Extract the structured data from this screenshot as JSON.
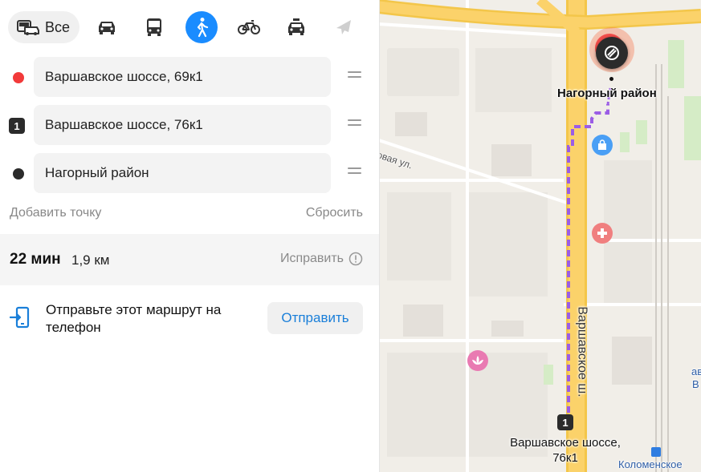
{
  "modes": {
    "all_label": "Все",
    "items": [
      {
        "name": "car-icon"
      },
      {
        "name": "bus-icon"
      },
      {
        "name": "pedestrian-icon",
        "active": true
      },
      {
        "name": "bicycle-icon"
      },
      {
        "name": "taxi-icon"
      },
      {
        "name": "airplane-icon"
      }
    ]
  },
  "route_points": [
    {
      "marker": "red-dot",
      "value": "Варшавское шоссе, 69к1"
    },
    {
      "marker": "number-badge",
      "marker_text": "1",
      "value": "Варшавское шоссе, 76к1"
    },
    {
      "marker": "black-dot",
      "value": "Нагорный район"
    }
  ],
  "actions": {
    "add_point": "Добавить точку",
    "reset": "Сбросить"
  },
  "summary": {
    "time": "22 мин",
    "distance": "1,9 км",
    "fix": "Исправить"
  },
  "send": {
    "text": "Отправьте этот маршрут на телефон",
    "button": "Отправить"
  },
  "map": {
    "destination_label": "Нагорный район",
    "street_label": "Варшавское ш.",
    "street_fragment": "овая ул.",
    "waypoint_badge": "1",
    "waypoint_label_line1": "Варшавское шоссе,",
    "waypoint_label_line2": "76к1",
    "metro_label": "Коломенское",
    "edge_label_1": "ав",
    "edge_label_2": "В",
    "colors": {
      "route": "#9b5de5",
      "highway": "#fbd26a",
      "accent": "#1a8cff",
      "start": "#f23a3a"
    }
  }
}
